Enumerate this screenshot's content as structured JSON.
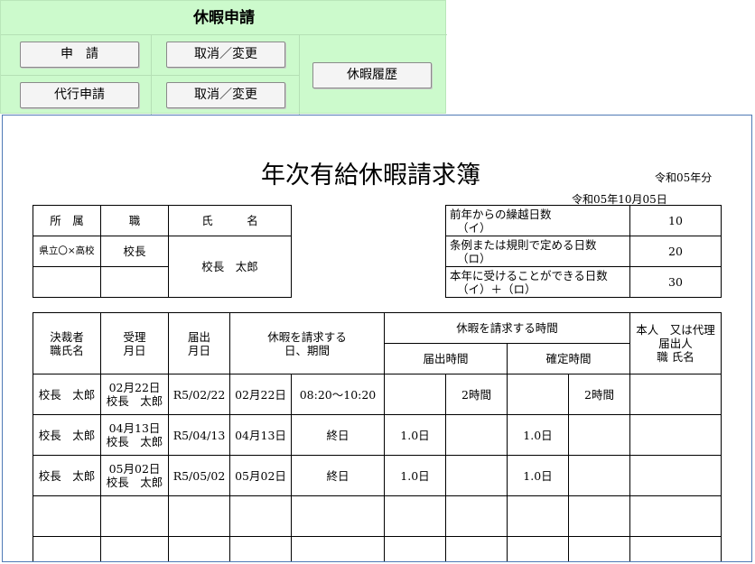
{
  "panel": {
    "title": "休暇申請",
    "buttons": {
      "apply": "申　請",
      "cancel_change_1": "取消／変更",
      "proxy_apply": "代行申請",
      "cancel_change_2": "取消／変更",
      "history": "休暇履歴"
    }
  },
  "document": {
    "title": "年次有給休暇請求簿",
    "year_label": "令和05年分",
    "date": "令和05年10月05日",
    "affiliation": {
      "headers": {
        "dept": "所　属",
        "position": "職",
        "name": "氏　　　名"
      },
      "dept": "県立〇×高校",
      "position": "校長",
      "name": "校長　太郎"
    },
    "days": [
      {
        "label": "前年からの繰越日数",
        "sub": "（イ）",
        "value": "10"
      },
      {
        "label": "条例または規則で定める日数",
        "sub": "（ロ）",
        "value": "20"
      },
      {
        "label": "本年に受けることができる日数",
        "sub": "（イ）＋（ロ）",
        "value": "30"
      }
    ],
    "log": {
      "headers": {
        "approver_1": "決裁者",
        "approver_2": "職氏名",
        "received_1": "受理",
        "received_2": "月日",
        "filed_1": "届出",
        "filed_2": "月日",
        "period_1": "休暇を請求する",
        "period_2": "日、期間",
        "time": "休暇を請求する時間",
        "filed_time": "届出時間",
        "confirmed_time": "確定時間",
        "person_1": "本人　又は代理",
        "person_2": "届出人",
        "person_3": "職 氏名"
      },
      "rows": [
        {
          "approver": "校長　太郎",
          "recv_date": "02月22日",
          "recv_name": "校長　太郎",
          "filed": "R5/02/22",
          "date": "02月22日",
          "period": "08:20〜10:20",
          "f_day": "",
          "f_hour": "2時間",
          "c_day": "",
          "c_hour": "2時間",
          "person": ""
        },
        {
          "approver": "校長　太郎",
          "recv_date": "04月13日",
          "recv_name": "校長　太郎",
          "filed": "R5/04/13",
          "date": "04月13日",
          "period": "終日",
          "f_day": "1.0日",
          "f_hour": "",
          "c_day": "1.0日",
          "c_hour": "",
          "person": ""
        },
        {
          "approver": "校長　太郎",
          "recv_date": "05月02日",
          "recv_name": "校長　太郎",
          "filed": "R5/05/02",
          "date": "05月02日",
          "period": "終日",
          "f_day": "1.0日",
          "f_hour": "",
          "c_day": "1.0日",
          "c_hour": "",
          "person": ""
        },
        {
          "approver": "",
          "recv_date": "",
          "recv_name": "",
          "filed": "",
          "date": "",
          "period": "",
          "f_day": "",
          "f_hour": "",
          "c_day": "",
          "c_hour": "",
          "person": ""
        },
        {
          "approver": "",
          "recv_date": "",
          "recv_name": "",
          "filed": "",
          "date": "",
          "period": "",
          "f_day": "",
          "f_hour": "",
          "c_day": "",
          "c_hour": "",
          "person": ""
        }
      ]
    }
  }
}
